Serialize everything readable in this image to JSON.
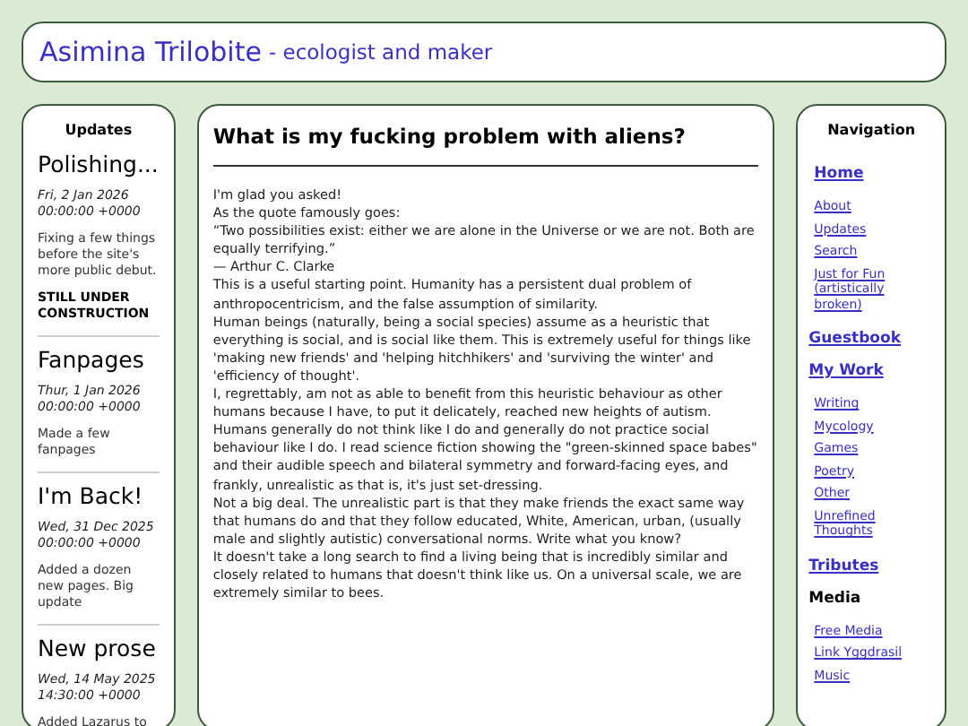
{
  "header": {
    "title": "Asimina Trilobite",
    "subtitle": "- ecologist and maker"
  },
  "updates": {
    "heading": "Updates",
    "posts": [
      {
        "title": "Polishing...",
        "date": "Fri, 2 Jan 2026 00:00:00 +0000",
        "body": "Fixing a few things before the site's more public debut.",
        "note": "STILL UNDER CONSTRUCTION"
      },
      {
        "title": "Fanpages",
        "date": "Thur, 1 Jan 2026 00:00:00 +0000",
        "body": "Made a few fanpages"
      },
      {
        "title": "I'm Back!",
        "date": "Wed, 31 Dec 2025 00:00:00 +0000",
        "body": "Added a dozen new pages. Big update"
      },
      {
        "title": "New prose",
        "date": "Wed, 14 May 2025 14:30:00 +0000",
        "body": "Added Lazarus to"
      }
    ]
  },
  "article": {
    "title": "What is my fucking problem with aliens?",
    "paragraphs": [
      "I'm glad you asked!",
      "As the quote famously goes:",
      "“Two possibilities exist: either we are alone in the Universe or we are not. Both are equally terrifying.”",
      "— Arthur C. Clarke",
      "This is a useful starting point. Humanity has a persistent dual problem of anthropocentricism, and the false assumption of similarity.",
      "Human beings (naturally, being a social species) assume as a heuristic that everything is social, and is social like them. This is extremely useful for things like 'making new friends' and 'helping hitchhikers' and 'surviving the winter' and 'efficiency of thought'.",
      "I, regrettably, am not as able to benefit from this heuristic behaviour as other humans because I have, to put it delicately, reached new heights of autism.",
      "Humans generally do not think like I do and generally do not practice social behaviour like I do. I read science fiction showing the \"green-skinned space babes\" and their audible speech and bilateral symmetry and forward-facing eyes, and frankly, unrealistic as that is, it's just set-dressing.",
      "Not a big deal. The unrealistic part is that they make friends the exact same way that humans do and that they follow educated, White, American, urban, (usually male and slightly autistic) conversational norms. Write what you know?",
      "It doesn't take a long search to find a living being that is incredibly similar and closely related to humans that doesn't think like us. On a universal scale, we are extremely similar to bees."
    ]
  },
  "navigation": {
    "heading": "Navigation",
    "sections": [
      {
        "label": "Home",
        "kind": "link",
        "children": [
          "About",
          "Updates",
          "Search",
          "Just for Fun (artistically broken)"
        ]
      },
      {
        "label": "Guestbook",
        "kind": "link"
      },
      {
        "label": "My Work",
        "kind": "link",
        "children": [
          "Writing",
          "Mycology",
          "Games",
          "Poetry",
          "Other",
          "Unrefined Thoughts"
        ]
      },
      {
        "label": "Tributes",
        "kind": "link"
      },
      {
        "label": "Media",
        "kind": "text",
        "children": [
          "Free Media",
          "Link Yggdrasil",
          "Music"
        ]
      }
    ]
  }
}
